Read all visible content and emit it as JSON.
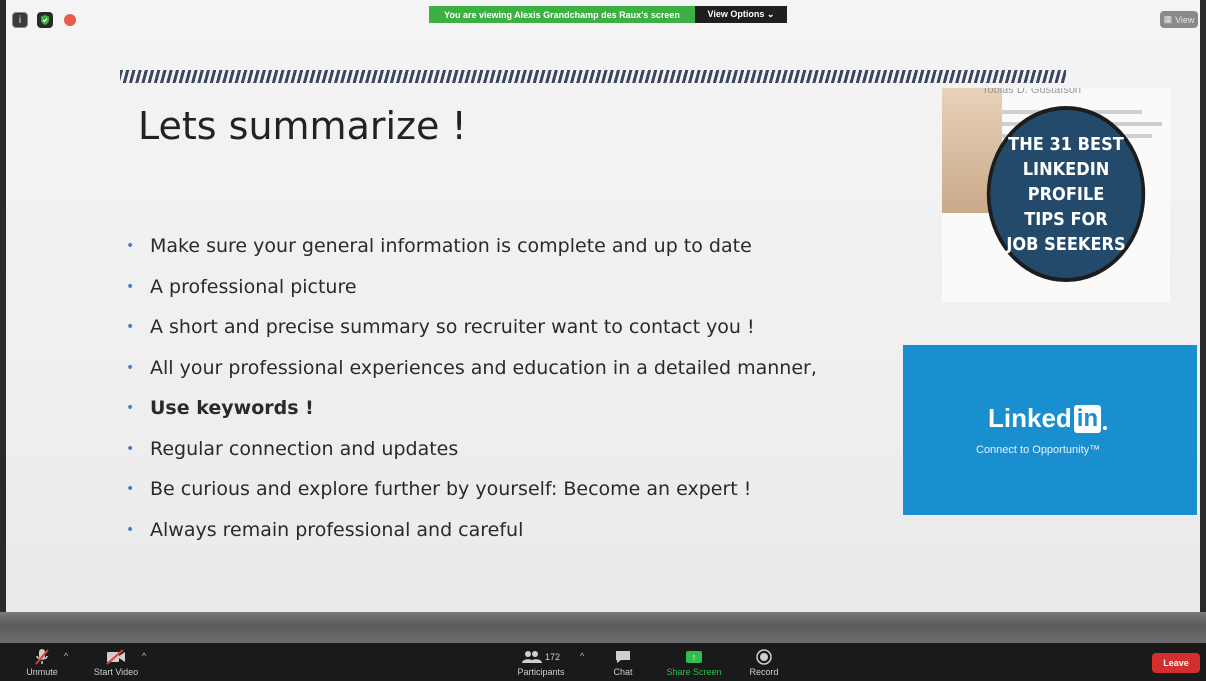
{
  "banner": {
    "viewing_text": "You are viewing Alexis Grandchamp des Raux's screen",
    "view_options": "View Options ⌄",
    "view_button": "View"
  },
  "slide": {
    "title": "Lets summarize !",
    "bullets": [
      {
        "text": " Make sure your general information is complete and up to date",
        "bold": false
      },
      {
        "text": "A professional picture",
        "bold": false
      },
      {
        "text": "A short and precise summary so recruiter want to contact you !",
        "bold": false
      },
      {
        "text": "All your professional experiences and education in a detailed manner,",
        "bold": false
      },
      {
        "text": "Use keywords !",
        "bold": true
      },
      {
        "text": "Regular connection and updates",
        "bold": false
      },
      {
        "text": "Be curious and explore further by yourself: Become an expert !",
        "bold": false
      },
      {
        "text": "Always remain professional and careful",
        "bold": false
      }
    ],
    "book": {
      "top_text": "Tobias D. Gustafson",
      "circle_lines": [
        "THE 31 BEST",
        "LINKEDIN PROFILE",
        "TIPS FOR",
        "JOB SEEKERS"
      ]
    },
    "linkedin": {
      "word": "Linked",
      "in": "in",
      "tagline": "Connect to Opportunity™"
    }
  },
  "toolbar": {
    "unmute": "Unmute",
    "start_video": "Start Video",
    "participants": "Participants",
    "participants_count": "172",
    "chat": "Chat",
    "share_screen": "Share Screen",
    "record": "Record",
    "leave": "Leave"
  },
  "colors": {
    "banner_green": "#3cb043",
    "linkedin_blue": "#1a8fcf",
    "leave_red": "#d32f2f",
    "share_green": "#2ebd4e"
  }
}
